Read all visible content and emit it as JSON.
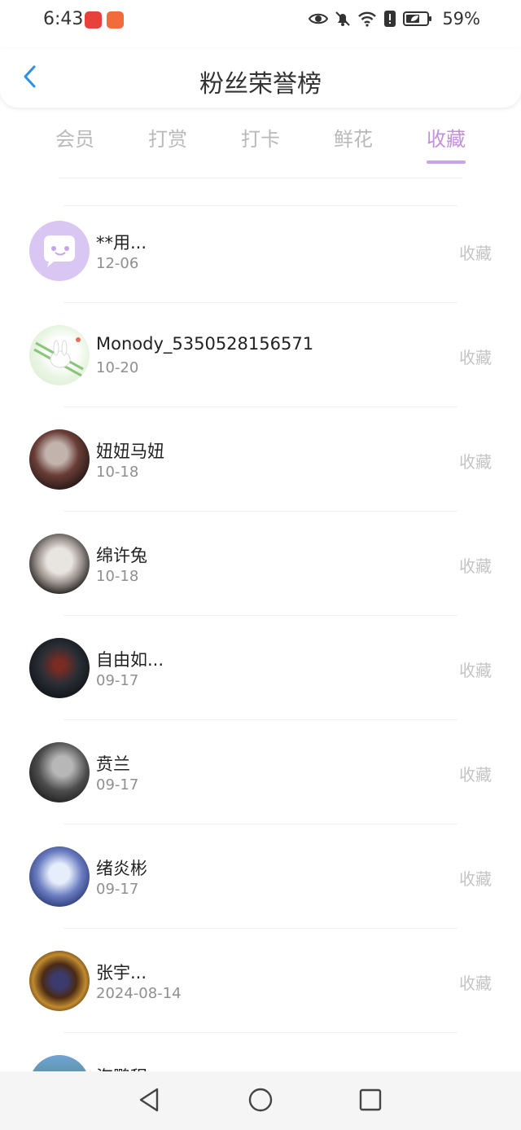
{
  "status_bar": {
    "time": "6:43",
    "battery": "59%"
  },
  "header": {
    "title": "粉丝荣誉榜"
  },
  "tabs": [
    {
      "label": "会员",
      "active": false
    },
    {
      "label": "打赏",
      "active": false
    },
    {
      "label": "打卡",
      "active": false
    },
    {
      "label": "鲜花",
      "active": false
    },
    {
      "label": "收藏",
      "active": true
    }
  ],
  "list": [
    {
      "name": "**用...",
      "date": "12-06",
      "action": "收藏"
    },
    {
      "name": "Monody_5350528156571",
      "date": "10-20",
      "action": "收藏"
    },
    {
      "name": "妞妞马妞",
      "date": "10-18",
      "action": "收藏"
    },
    {
      "name": "绵许兔",
      "date": "10-18",
      "action": "收藏"
    },
    {
      "name": "自由如...",
      "date": "09-17",
      "action": "收藏"
    },
    {
      "name": "贲兰",
      "date": "09-17",
      "action": "收藏"
    },
    {
      "name": "绪炎彬",
      "date": "09-17",
      "action": "收藏"
    },
    {
      "name": "张宇...",
      "date": "2024-08-14",
      "action": "收藏"
    },
    {
      "name": "海鹏程",
      "date": "",
      "action": ""
    }
  ],
  "colors": {
    "accent": "#c58fdc",
    "back_arrow": "#2e8fe6"
  },
  "icons": {
    "back": "chevron-left-icon",
    "nav_back": "triangle-back-icon",
    "nav_home": "circle-home-icon",
    "nav_recents": "square-recents-icon"
  }
}
